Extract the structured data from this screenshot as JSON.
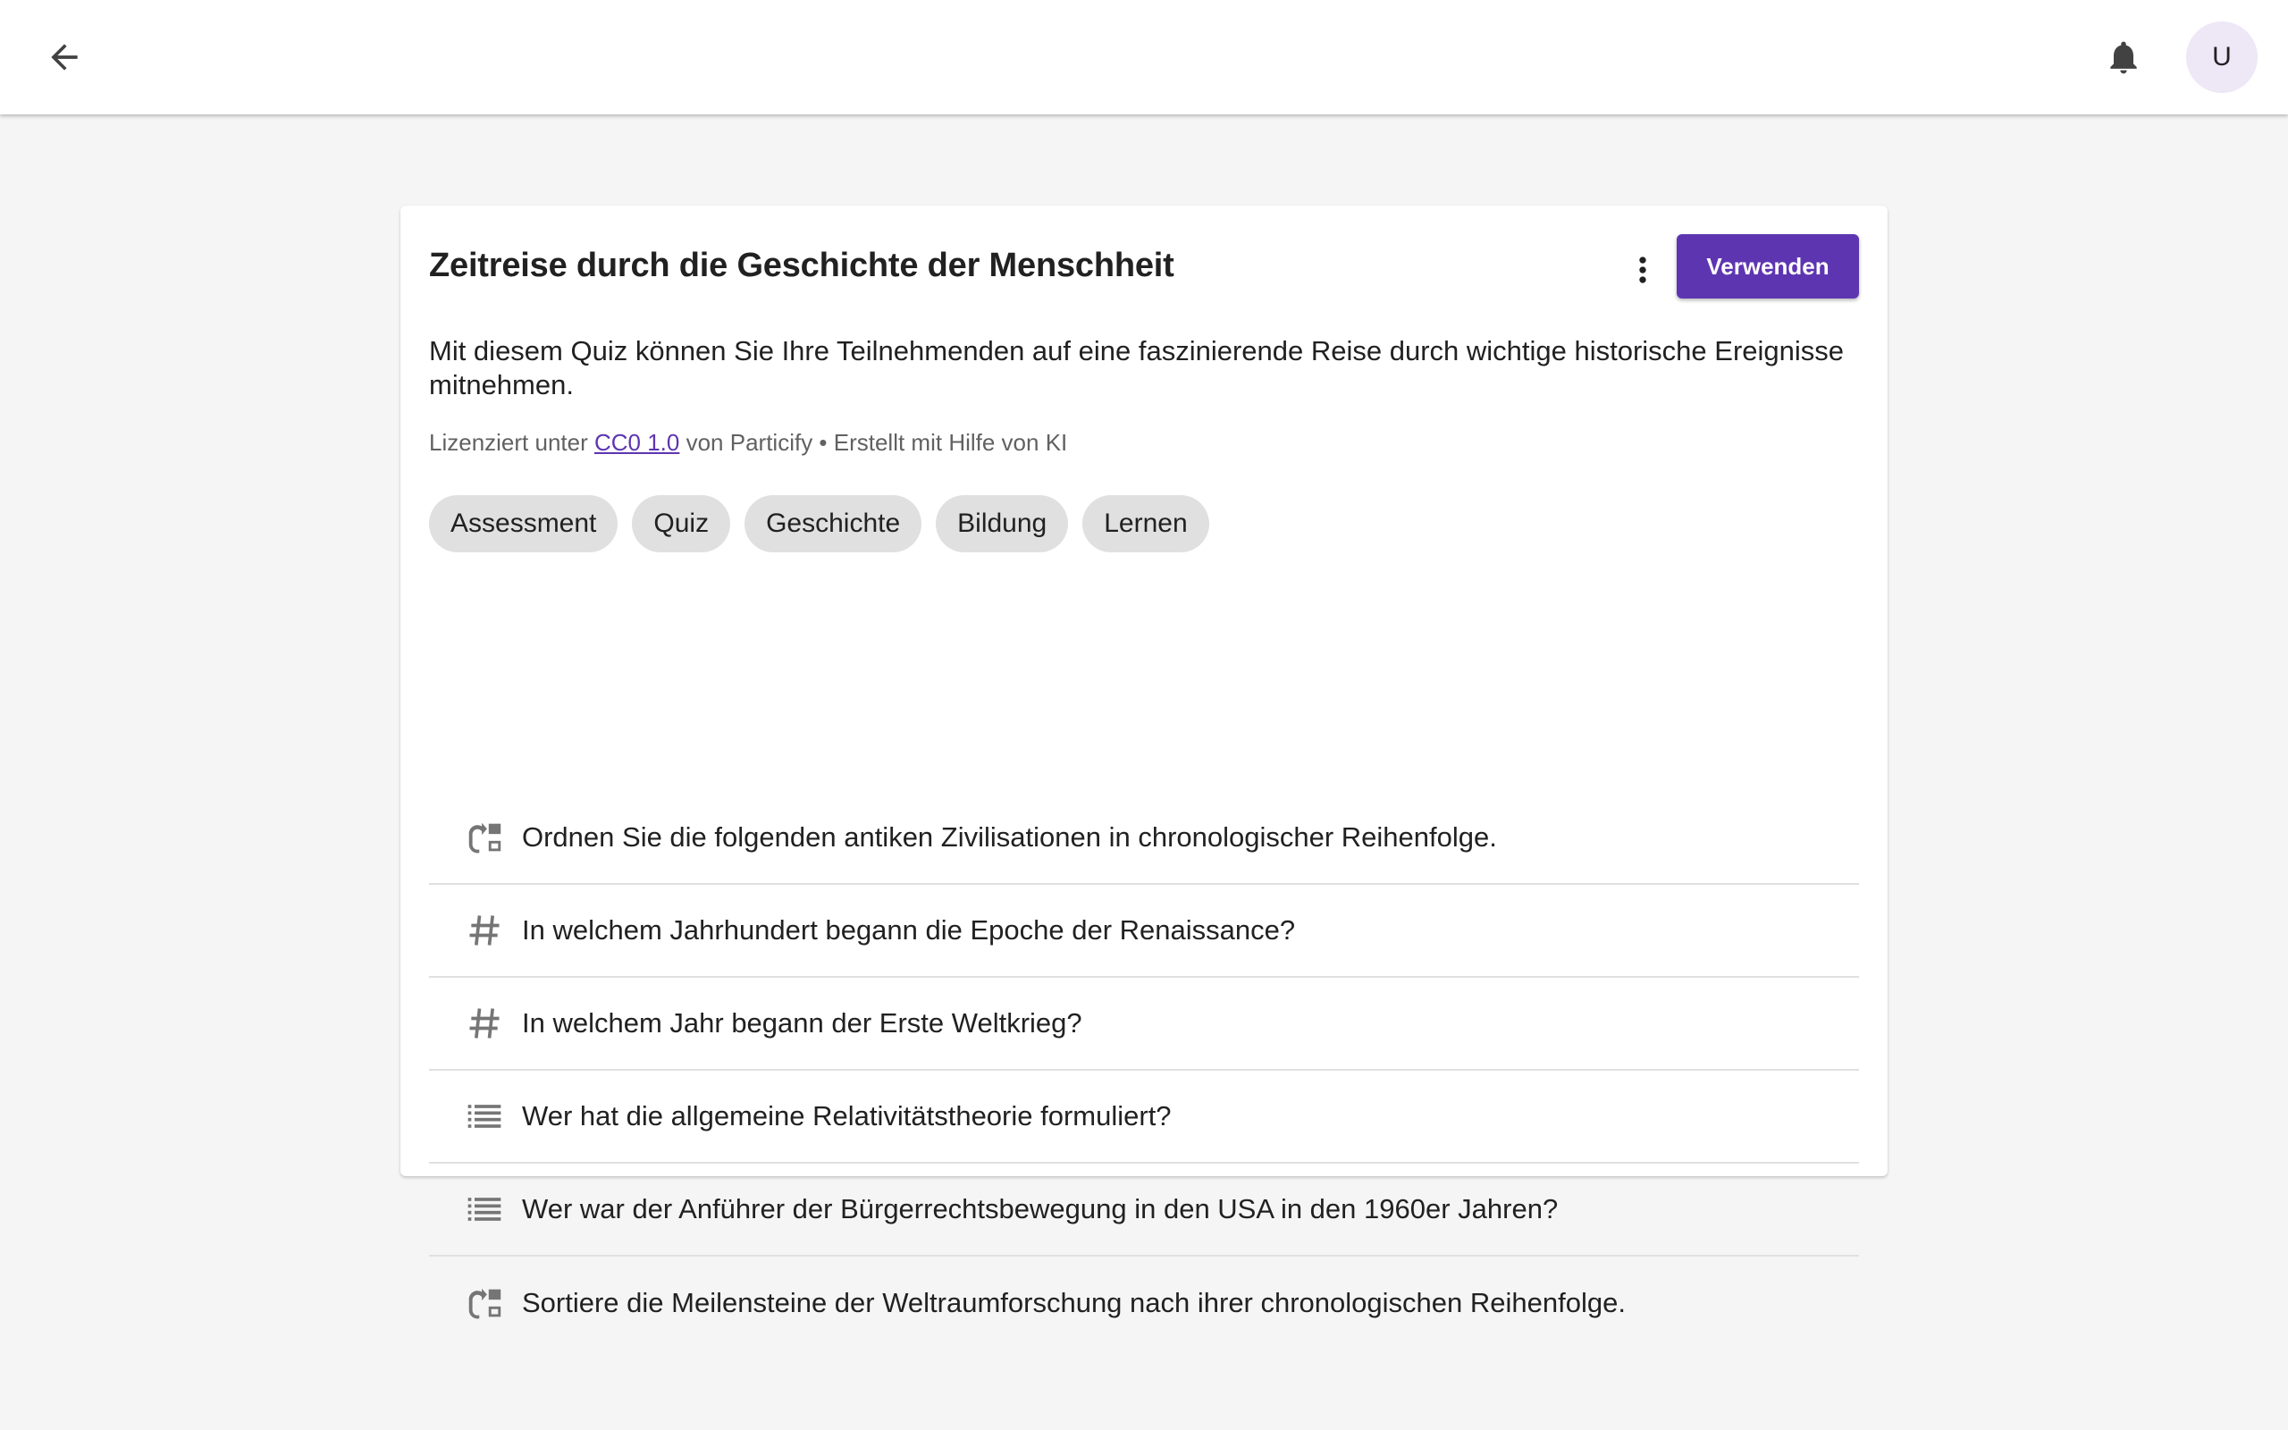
{
  "topbar": {
    "back_icon": "arrow-back-icon",
    "bell_icon": "bell-icon",
    "avatar_initial": "U"
  },
  "card": {
    "title": "Zeitreise durch die Geschichte der Menschheit",
    "use_label": "Verwenden",
    "more_icon": "more-vert-icon",
    "description": "Mit diesem Quiz können Sie Ihre Teilnehmenden auf eine faszinierende Reise durch wichtige historische Ereig­nisse mitnehmen.",
    "license": {
      "prefix": "Lizenziert unter ",
      "link_text": "CC0 1.0",
      "suffix": " von Particify • Erstellt mit Hilfe von KI"
    },
    "tags": [
      "Assessment",
      "Quiz",
      "Geschichte",
      "Bildung",
      "Lernen"
    ],
    "questions": [
      {
        "icon": "sort-order-icon",
        "text": "Ordnen Sie die folgenden antiken Zivilisationen in chronologischer Reihenfolge."
      },
      {
        "icon": "numeric-hash-icon",
        "text": "In welchem Jahrhundert begann die Epoche der Renaissance?"
      },
      {
        "icon": "numeric-hash-icon",
        "text": "In welchem Jahr begann der Erste Weltkrieg?"
      },
      {
        "icon": "list-icon",
        "text": "Wer hat die allgemeine Relativitätstheorie formuliert?"
      },
      {
        "icon": "list-icon",
        "text": "Wer war der Anführer der Bürgerrechtsbewegung in den USA in den 1960er Jahren?"
      },
      {
        "icon": "sort-order-icon",
        "text": "Sortiere die Meilensteine der Weltraumforschung nach ihrer chronologischen Reihenfolge."
      }
    ]
  },
  "colors": {
    "accent": "#5e35b1",
    "avatar_bg": "#ede7f6",
    "page_bg": "#f5f5f5",
    "chip_bg": "#e0e0e0"
  }
}
